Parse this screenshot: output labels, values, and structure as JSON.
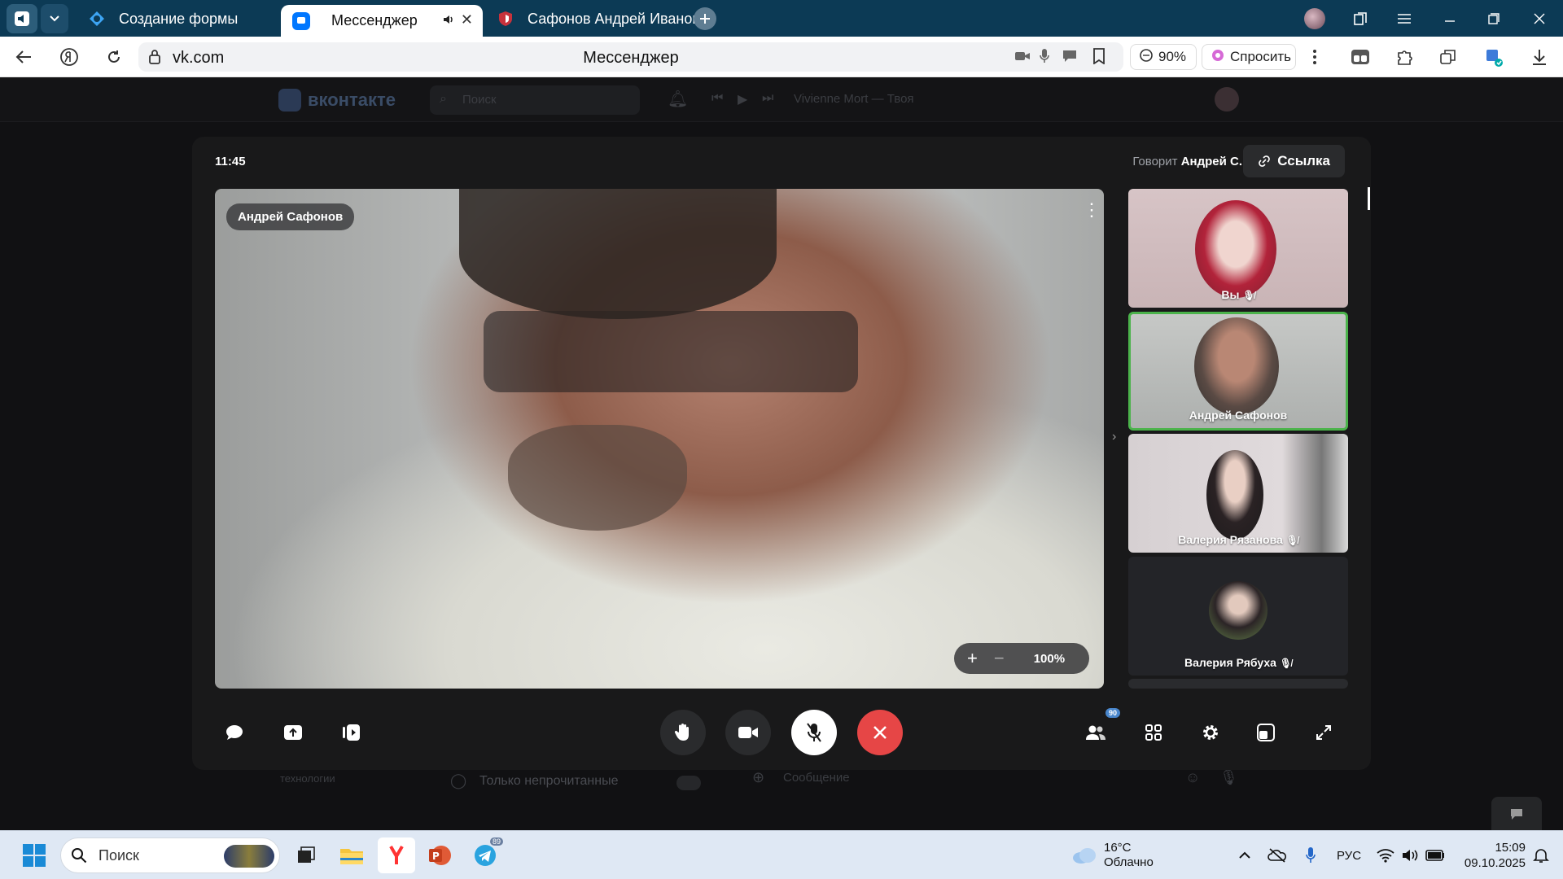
{
  "browser": {
    "tabs": [
      {
        "title": "Создание формы"
      },
      {
        "title": "Мессенджер"
      },
      {
        "title": "Сафонов Андрей Иванов"
      }
    ],
    "url": "vk.com",
    "page_title": "Мессенджер",
    "zoom": "90%",
    "ask_label": "Спросить"
  },
  "vk_background": {
    "logo": "вконтакте",
    "search_placeholder": "Поиск",
    "now_playing": "Vivienne Mort — Твоя",
    "sidebar_text": "технологии",
    "filter_label": "Только непрочитанные",
    "message_placeholder": "Сообщение"
  },
  "call": {
    "time": "11:45",
    "speaking_prefix": "Говорит",
    "speaking_name": "Андрей С.",
    "link_label": "Ссылка",
    "main_participant": "Андрей Сафонов",
    "zoom_level": "100%",
    "participants": [
      {
        "name": "Вы",
        "muted": true
      },
      {
        "name": "Андрей Сафонов",
        "muted": false,
        "active_speaker": true
      },
      {
        "name": "Валерия Рязанова",
        "muted": true
      },
      {
        "name": "Валерия Рябуха",
        "muted": true
      }
    ],
    "participants_badge": "90",
    "end_call_color": "#e64646",
    "speaker_border_color": "#4bb34b"
  },
  "taskbar": {
    "search_placeholder": "Поиск",
    "telegram_badge": "89",
    "weather_temp": "16°C",
    "weather_desc": "Облачно",
    "language": "РУС",
    "time": "15:09",
    "date": "09.10.2025"
  }
}
